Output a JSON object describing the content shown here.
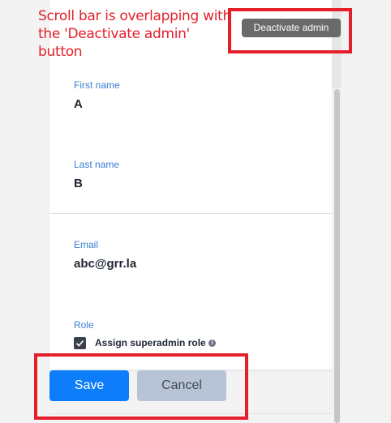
{
  "annotation": {
    "text": "Scroll bar is overlapping with the 'Deactivate admin' button",
    "color": "#e3202a"
  },
  "header": {
    "deactivate_label": "Deactivate admin"
  },
  "form": {
    "first_name": {
      "label": "First name",
      "value": "A"
    },
    "last_name": {
      "label": "Last name",
      "value": "B"
    },
    "email": {
      "label": "Email",
      "value": "abc@grr.la"
    },
    "role": {
      "label": "Role",
      "checkbox_label": "Assign superadmin role",
      "checked": true,
      "info_icon": "info-icon"
    }
  },
  "footer": {
    "save_label": "Save",
    "cancel_label": "Cancel"
  },
  "colors": {
    "accent": "#0d7dfc",
    "label_blue": "#3a7fd5",
    "annotation_red": "#e3202a"
  }
}
